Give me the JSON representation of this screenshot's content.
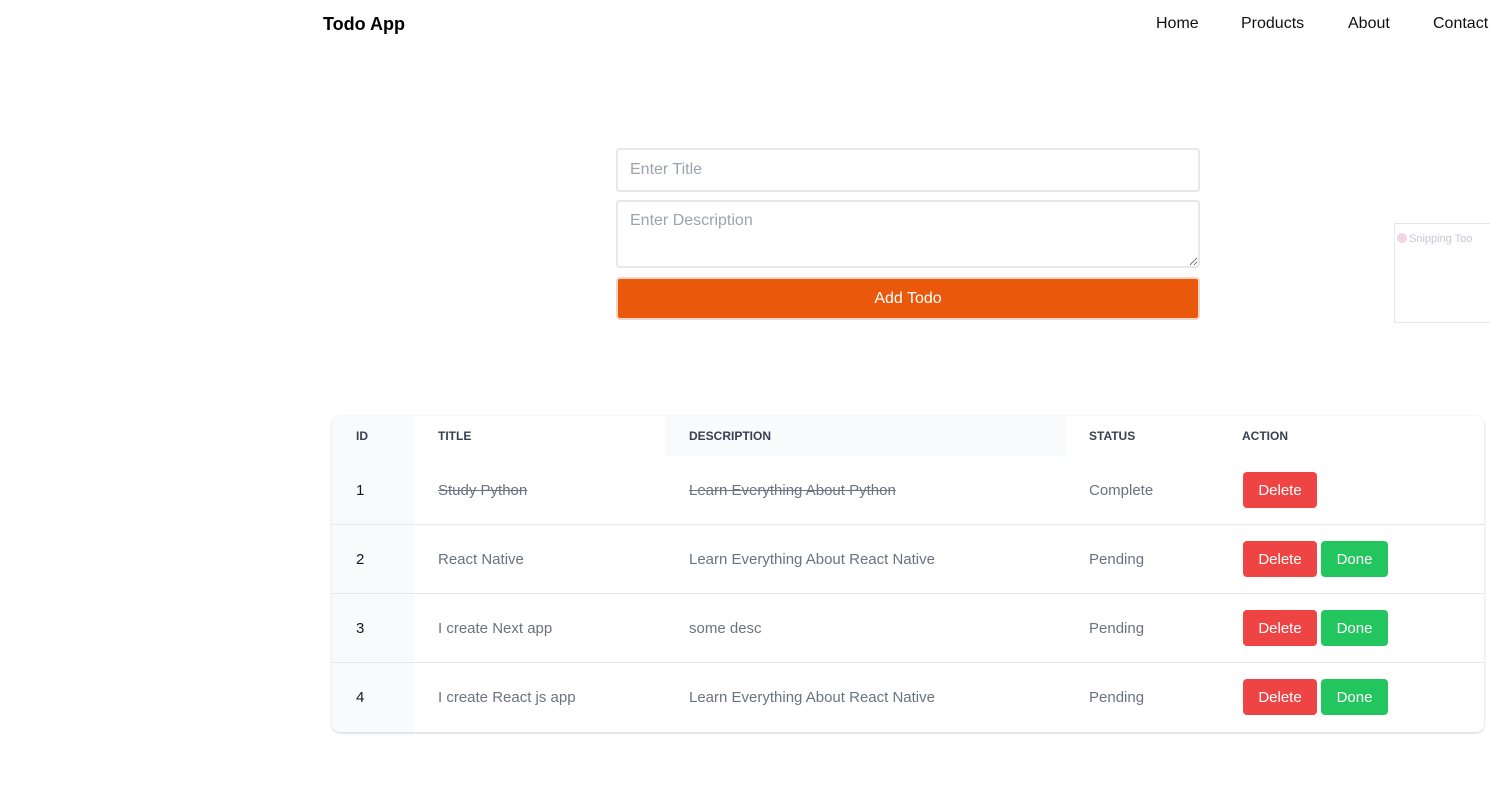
{
  "header": {
    "brand": "Todo App",
    "nav": [
      "Home",
      "Products",
      "About",
      "Contact"
    ]
  },
  "form": {
    "title_placeholder": "Enter Title",
    "description_placeholder": "Enter Description",
    "submit_label": "Add Todo"
  },
  "overlay": {
    "label": "Snipping Too"
  },
  "table": {
    "columns": [
      "ID",
      "TITLE",
      "DESCRIPTION",
      "STATUS",
      "ACTION"
    ],
    "delete_label": "Delete",
    "done_label": "Done",
    "rows": [
      {
        "id": "1",
        "title": "Study Python",
        "description": "Learn Everything About Python",
        "status": "Complete"
      },
      {
        "id": "2",
        "title": "React Native",
        "description": "Learn Everything About React Native",
        "status": "Pending"
      },
      {
        "id": "3",
        "title": "I create Next app",
        "description": "some desc",
        "status": "Pending"
      },
      {
        "id": "4",
        "title": "I create React js app",
        "description": "Learn Everything About React Native",
        "status": "Pending"
      }
    ]
  },
  "colors": {
    "accent": "#ea580c",
    "delete": "#ef4444",
    "done": "#22c55e"
  }
}
